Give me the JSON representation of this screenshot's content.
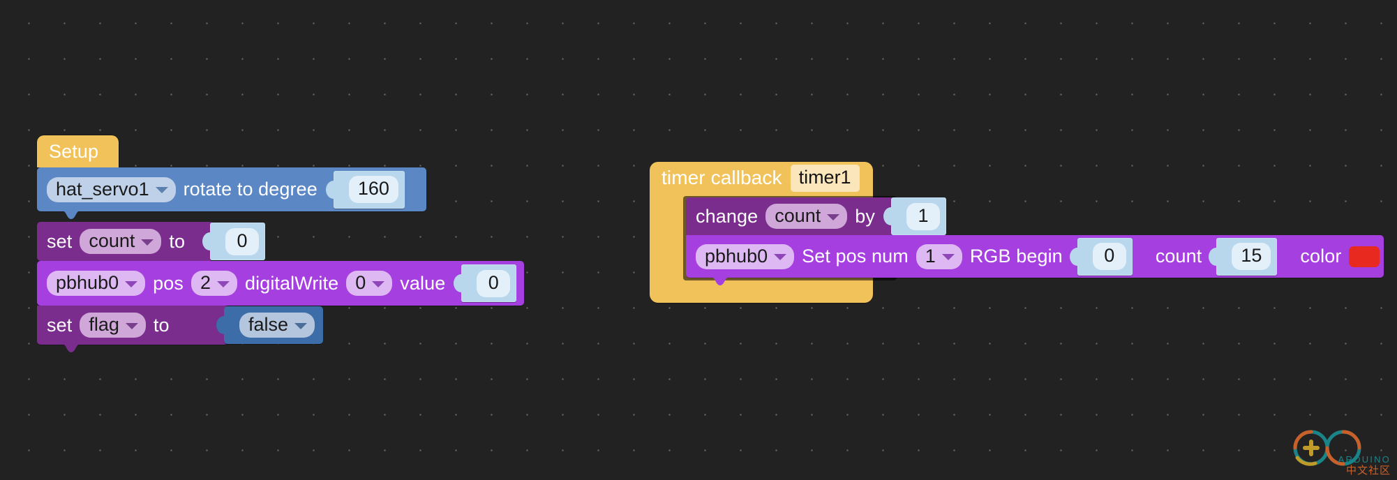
{
  "workspace": {
    "background_color": "#222222",
    "grid_dot_color": "#6d6d6d"
  },
  "palette": {
    "hat_yellow": "#f2c25a",
    "servo_blue": "#5b87c5",
    "variable_purple_dark": "#7b2d8e",
    "device_purple": "#a63fe0",
    "value_blue": "#b9d7ec",
    "bool_blue": "#3d6da8",
    "rgb_color_swatch": "#e8291f"
  },
  "scripts": [
    {
      "name": "setup-script",
      "hat": {
        "label": "Setup"
      },
      "blocks": [
        {
          "name": "servo-rotate-block",
          "device": "hat_servo1",
          "text": "rotate to degree",
          "degree": "160"
        },
        {
          "name": "set-count-block",
          "set_label": "set",
          "variable": "count",
          "to_label": "to",
          "value": "0"
        },
        {
          "name": "pbhub-digitalwrite-block",
          "device": "pbhub0",
          "pos_label": "pos",
          "pos": "2",
          "write_label": "digitalWrite",
          "channel": "0",
          "value_label": "value",
          "value": "0"
        },
        {
          "name": "set-flag-block",
          "set_label": "set",
          "variable": "flag",
          "to_label": "to",
          "value": "false"
        }
      ]
    },
    {
      "name": "timer-callback-script",
      "hat": {
        "label": "timer callback",
        "timer_name": "timer1"
      },
      "blocks": [
        {
          "name": "change-count-block",
          "change_label": "change",
          "variable": "count",
          "by_label": "by",
          "value": "1"
        },
        {
          "name": "pbhub-rgb-block",
          "device": "pbhub0",
          "setpos_label": "Set pos num",
          "pos": "1",
          "rgb_label": "RGB begin",
          "begin": "0",
          "count_label": "count",
          "count": "15",
          "color_label": "color",
          "color": "#e8291f"
        }
      ]
    }
  ],
  "watermark": {
    "brand": "ARDUINO",
    "subtitle": "中文社区",
    "teal": "#1b8a8f",
    "orange": "#d2642a",
    "yellow": "#c8a22a"
  }
}
